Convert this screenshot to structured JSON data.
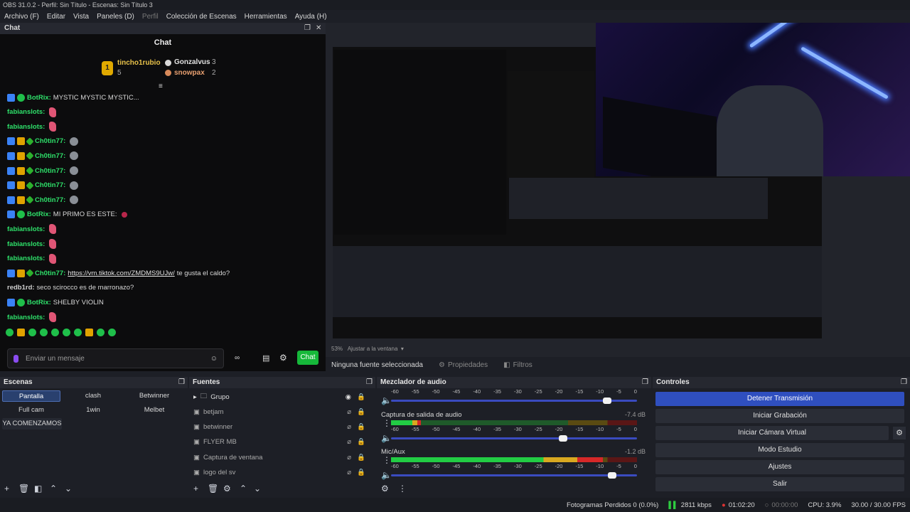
{
  "window": {
    "title": "OBS 31.0.2 - Perfil: Sin Título - Escenas: Sin Título 3"
  },
  "menu": [
    {
      "label": "Archivo (F)",
      "dim": false
    },
    {
      "label": "Editar",
      "dim": false
    },
    {
      "label": "Vista",
      "dim": false
    },
    {
      "label": "Paneles (D)",
      "dim": false
    },
    {
      "label": "Perfil",
      "dim": true
    },
    {
      "label": "Colección de Escenas",
      "dim": false
    },
    {
      "label": "Herramientas",
      "dim": false
    },
    {
      "label": "Ayuda (H)",
      "dim": false
    }
  ],
  "chat": {
    "dock_title": "Chat",
    "title": "Chat",
    "leaders": [
      {
        "rank": "1",
        "name": "tincho1rubio",
        "count": "5"
      },
      {
        "name": "Gonzalvus",
        "count": "3"
      },
      {
        "name": "snowpax",
        "count": "2"
      }
    ],
    "messages": [
      {
        "user": "BotRix:",
        "color": "#2ee06a",
        "badges": [
          "b",
          "g"
        ],
        "text": "MYSTIC MYSTIC MYSTIC..."
      },
      {
        "user": "fabianslots:",
        "color": "#2ee06a",
        "badges": [],
        "text": ""
      },
      {
        "user": "fabianslots:",
        "color": "#2ee06a",
        "badges": [],
        "text": ""
      },
      {
        "user": "Ch0tin77:",
        "color": "#2ee06a",
        "badges": [
          "b",
          "y",
          "s"
        ],
        "text": ""
      },
      {
        "user": "Ch0tin77:",
        "color": "#2ee06a",
        "badges": [
          "b",
          "y",
          "s"
        ],
        "text": ""
      },
      {
        "user": "Ch0tin77:",
        "color": "#2ee06a",
        "badges": [
          "b",
          "y",
          "s"
        ],
        "text": ""
      },
      {
        "user": "Ch0tin77:",
        "color": "#2ee06a",
        "badges": [
          "b",
          "y",
          "s"
        ],
        "text": ""
      },
      {
        "user": "Ch0tin77:",
        "color": "#2ee06a",
        "badges": [
          "b",
          "y",
          "s"
        ],
        "text": ""
      },
      {
        "user": "BotRix:",
        "color": "#2ee06a",
        "badges": [
          "b",
          "g"
        ],
        "text": "MI PRIMO ES ESTE:"
      },
      {
        "user": "fabianslots:",
        "color": "#2ee06a",
        "badges": [],
        "text": ""
      },
      {
        "user": "fabianslots:",
        "color": "#2ee06a",
        "badges": [],
        "text": ""
      },
      {
        "user": "fabianslots:",
        "color": "#2ee06a",
        "badges": [],
        "text": ""
      },
      {
        "user": "Ch0tin77:",
        "color": "#2ee06a",
        "badges": [
          "b",
          "y",
          "s"
        ],
        "text": "https://vm.tiktok.com/ZMDMS9UJw/",
        "extra": " te gusta el caldo?"
      },
      {
        "user": "redb1rd:",
        "color": "#cfcfcf",
        "badges": [],
        "text": "seco scirocco es de marronazo?"
      },
      {
        "user": "BotRix:",
        "color": "#2ee06a",
        "badges": [
          "b",
          "g"
        ],
        "text": "SHELBY VIOLIN"
      },
      {
        "user": "fabianslots:",
        "color": "#2ee06a",
        "badges": [],
        "text": ""
      }
    ],
    "input_placeholder": "Enviar un mensaje",
    "send_label": "Chat"
  },
  "preview": {
    "zoom": "53%",
    "fit_label": "Ajustar a la ventana",
    "no_source": "Ninguna fuente seleccionada",
    "properties": "Propiedades",
    "filters": "Filtros"
  },
  "scenes": {
    "title": "Escenas",
    "items": [
      "Pantalla",
      "clash",
      "Betwinner",
      "Full cam",
      "1win",
      "Melbet",
      "YA COMENZAMOS"
    ]
  },
  "sources": {
    "title": "Fuentes",
    "items": [
      "Grupo",
      "betjam",
      "betwinner",
      "FLYER MB",
      "Captura de ventana",
      "logo del sv"
    ]
  },
  "mixer": {
    "title": "Mezclador de audio",
    "ticks": [
      "-60",
      "-55",
      "-50",
      "-45",
      "-40",
      "-35",
      "-30",
      "-25",
      "-20",
      "-15",
      "-10",
      "-5",
      "0"
    ],
    "channels": [
      {
        "name": "",
        "db": "",
        "level": 0.0,
        "volume": 0.88
      },
      {
        "name": "Captura de salida de audio",
        "db": "-7.4 dB",
        "level": 0.12,
        "volume": 0.7
      },
      {
        "name": "Mic/Aux",
        "db": "-1.2 dB",
        "level": 0.86,
        "volume": 0.9
      }
    ]
  },
  "controls": {
    "title": "Controles",
    "buttons": [
      "Detener Transmisión",
      "Iniciar Grabación",
      "Iniciar Cámara Virtual",
      "Modo Estudio",
      "Ajustes",
      "Salir"
    ]
  },
  "status": {
    "dropped": "Fotogramas Perdidos 0 (0.0%)",
    "bitrate": "2811 kbps",
    "stream_time": "01:02:20",
    "rec_time": "00:00:00",
    "cpu": "CPU: 3.9%",
    "fps": "30.00 / 30.00 FPS"
  },
  "colors": {
    "accent": "#2f4fbf",
    "chat_green": "#16b83a",
    "meter_green": "#22cc44"
  }
}
